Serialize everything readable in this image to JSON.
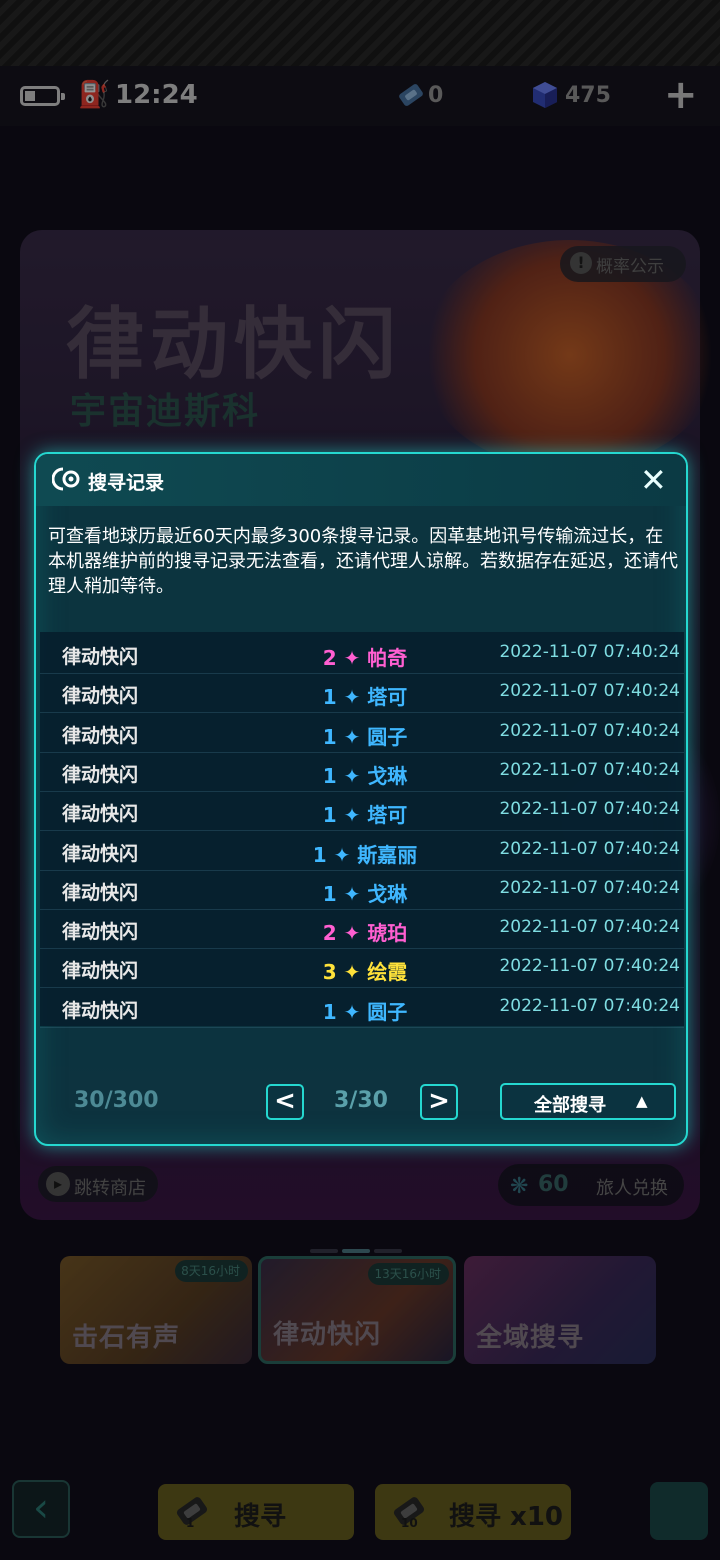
{
  "status": {
    "time": "12:24",
    "tickets": "0",
    "crystals": "475",
    "add_label": "+"
  },
  "banner": {
    "title": "律动快闪",
    "subtitle": "宇宙迪斯科",
    "probability_label": "概率公示",
    "shop_label": "跳转商店",
    "exchange_count": "60",
    "exchange_label": "旅人兑换"
  },
  "tabs": [
    {
      "label": "击石有声",
      "timer": "8天16小时"
    },
    {
      "label": "律动快闪",
      "timer": "13天16小时"
    },
    {
      "label": "全域搜寻",
      "timer": ""
    }
  ],
  "actions": {
    "search_1": "搜寻",
    "search_10": "搜寻 x10",
    "ticket_1": "1",
    "ticket_10": "10"
  },
  "modal": {
    "title": "搜寻记录",
    "close": "✕",
    "notice": "可查看地球历最近60天内最多300条搜寻记录。因革基地讯号传输流过长，在本机器维护前的搜寻记录无法查看，还请代理人谅解。若数据存在延迟，还请代理人稍加等待。",
    "records": [
      {
        "banner": "律动快闪",
        "stars": "2",
        "name": "帕奇",
        "color": "#ff5fd1",
        "time": "2022-11-07 07:40:24"
      },
      {
        "banner": "律动快闪",
        "stars": "1",
        "name": "塔可",
        "color": "#3fb7ff",
        "time": "2022-11-07 07:40:24"
      },
      {
        "banner": "律动快闪",
        "stars": "1",
        "name": "圆子",
        "color": "#3fb7ff",
        "time": "2022-11-07 07:40:24"
      },
      {
        "banner": "律动快闪",
        "stars": "1",
        "name": "戈琳",
        "color": "#3fb7ff",
        "time": "2022-11-07 07:40:24"
      },
      {
        "banner": "律动快闪",
        "stars": "1",
        "name": "塔可",
        "color": "#3fb7ff",
        "time": "2022-11-07 07:40:24"
      },
      {
        "banner": "律动快闪",
        "stars": "1",
        "name": "斯嘉丽",
        "color": "#3fb7ff",
        "time": "2022-11-07 07:40:24"
      },
      {
        "banner": "律动快闪",
        "stars": "1",
        "name": "戈琳",
        "color": "#3fb7ff",
        "time": "2022-11-07 07:40:24"
      },
      {
        "banner": "律动快闪",
        "stars": "2",
        "name": "琥珀",
        "color": "#ff5fd1",
        "time": "2022-11-07 07:40:24"
      },
      {
        "banner": "律动快闪",
        "stars": "3",
        "name": "绘霞",
        "color": "#ffe23a",
        "time": "2022-11-07 07:40:24"
      },
      {
        "banner": "律动快闪",
        "stars": "1",
        "name": "圆子",
        "color": "#3fb7ff",
        "time": "2022-11-07 07:40:24"
      }
    ],
    "count": "30/300",
    "page": "3/30",
    "prev": "<",
    "next": ">",
    "filter_label": "全部搜寻",
    "filter_caret": "▲"
  }
}
